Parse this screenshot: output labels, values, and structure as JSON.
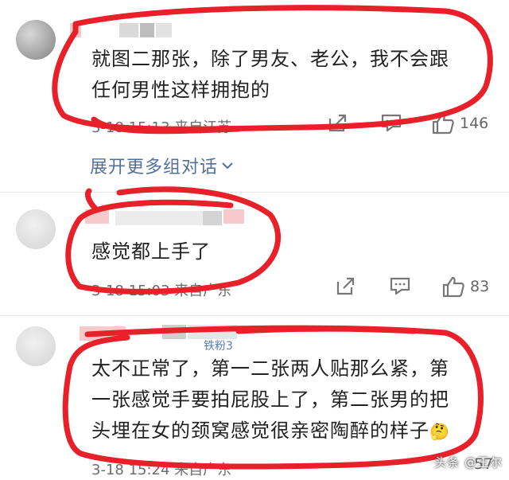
{
  "comments": [
    {
      "text_line1": "就图二那张，除了男友、老公，我不会跟",
      "text_line2": "任何男性这样拥抱的",
      "meta": "3-18 15:13 来自江苏",
      "likes": "146"
    },
    {
      "text_line1": "感觉都上手了",
      "meta": "3-18 15:03 来自广东",
      "likes": "83"
    },
    {
      "text_line1": "太不正常了，第一二张两人贴那么紧，第",
      "text_line2": "一张感觉手要拍屁股上了，第二张男的把",
      "text_line3": "头埋在女的颈窝感觉很亲密陶醉的样子",
      "emoji": "🤔",
      "meta": "3-18 15:24 来自广东",
      "likes": "57",
      "fans_badge": "铁粉3"
    }
  ],
  "expand_label": "展开更多组对话",
  "watermark": "头条 @王尔",
  "colors": {
    "text": "#222222",
    "meta": "#6c6c6c",
    "link": "#53709a",
    "annotation_red": "#e8202a"
  },
  "icons": {
    "share": "share-icon",
    "comment": "comment-icon",
    "like": "thumbs-up-icon",
    "expand": "chevron-down-icon"
  }
}
